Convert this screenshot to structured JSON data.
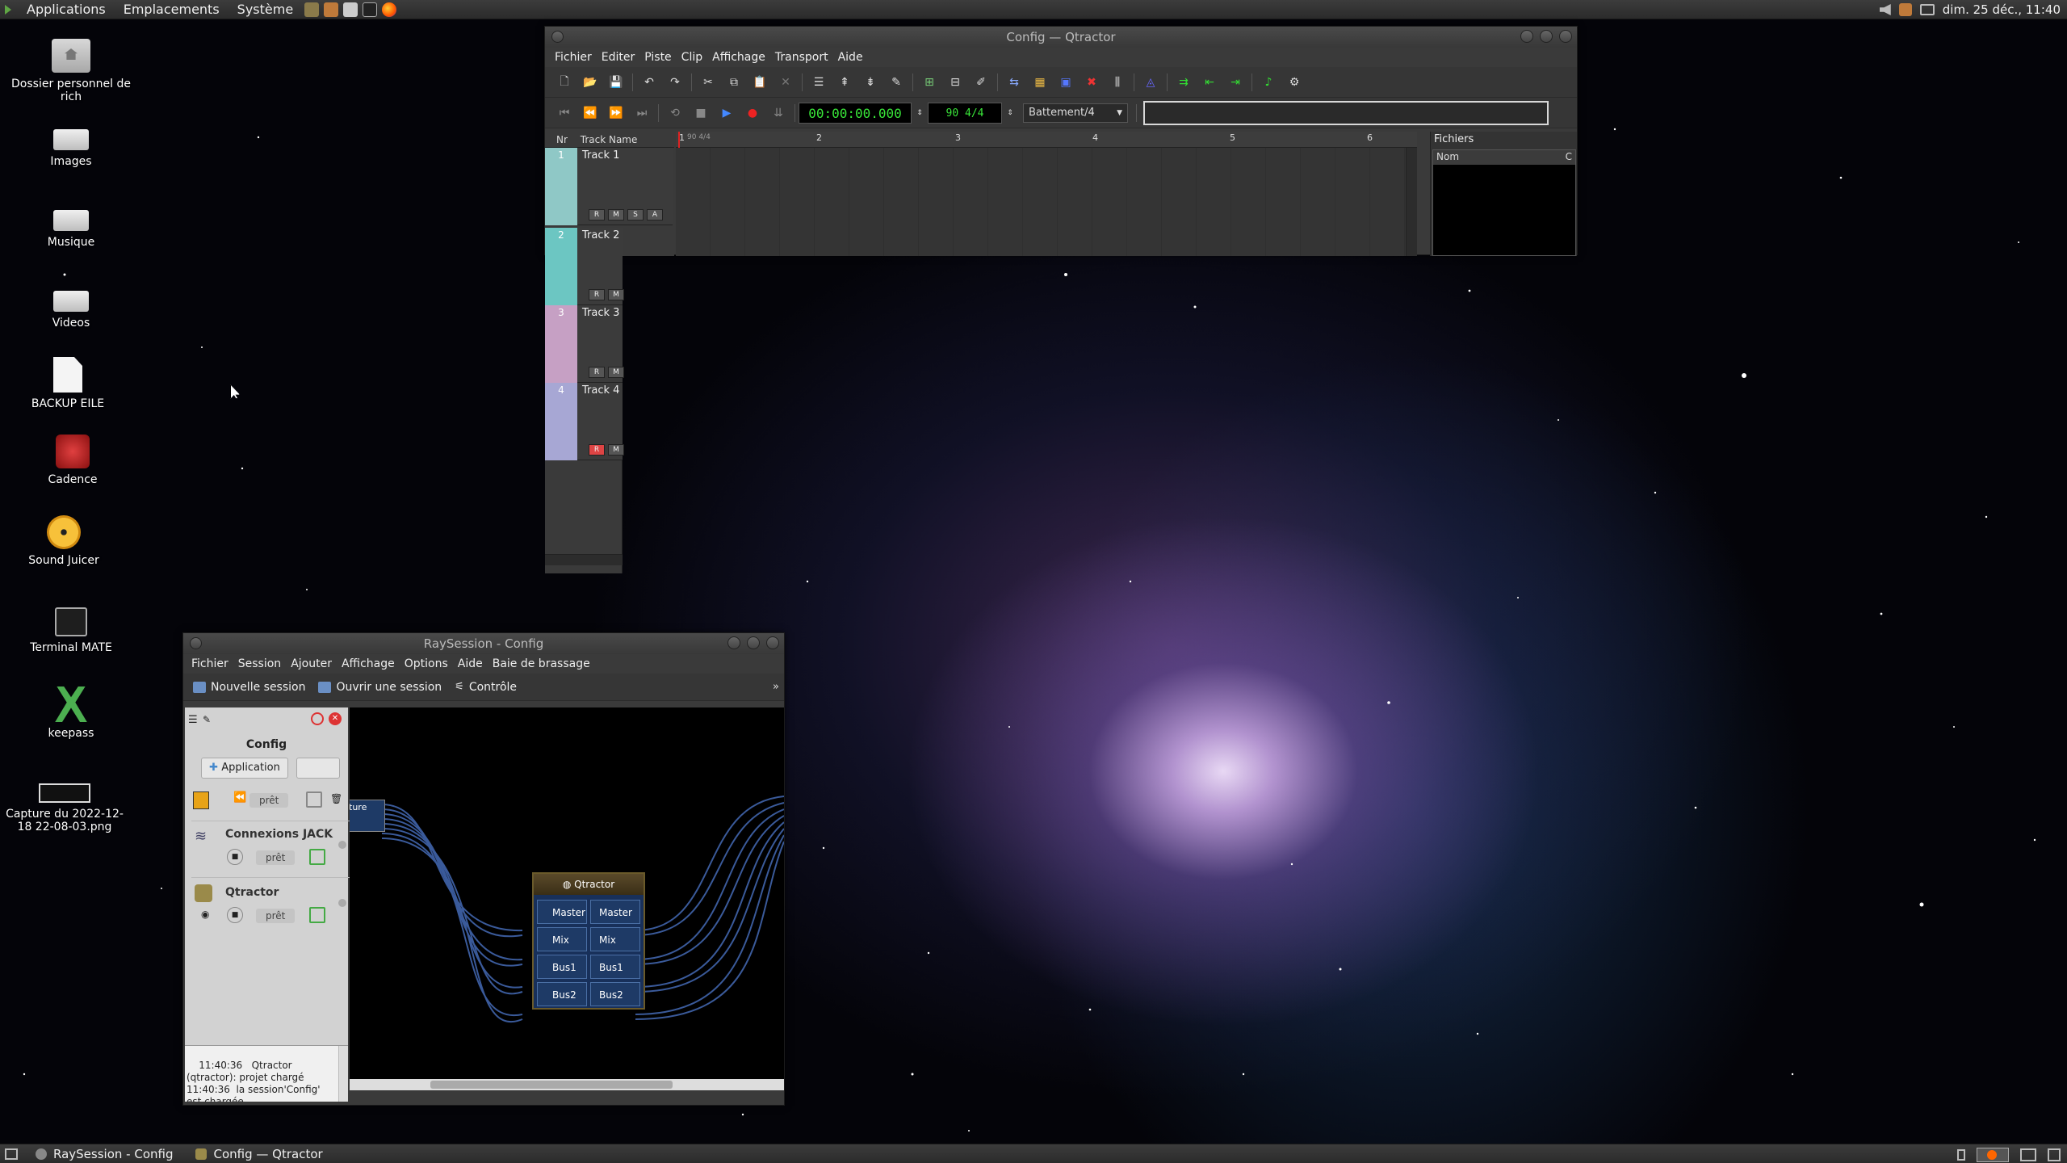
{
  "top_panel": {
    "menus": [
      "Applications",
      "Emplacements",
      "Système"
    ],
    "clock": "dim. 25 déc., 11:40"
  },
  "desktop_icons": [
    {
      "label": "Dossier personnel de rich",
      "icon": "home-folder-icon"
    },
    {
      "label": "Images",
      "icon": "drive-icon"
    },
    {
      "label": "Musique",
      "icon": "drive-icon"
    },
    {
      "label": "Videos",
      "icon": "drive-icon"
    },
    {
      "label": "BACKUP EILE",
      "icon": "file-icon"
    },
    {
      "label": "Cadence",
      "icon": "cadence-icon"
    },
    {
      "label": "Sound Juicer",
      "icon": "cd-icon"
    },
    {
      "label": "Terminal MATE",
      "icon": "terminal-icon"
    },
    {
      "label": "keepass",
      "icon": "keepass-icon"
    },
    {
      "label": "Capture du 2022-12-18 22-08-03.png",
      "icon": "screenshot-icon"
    }
  ],
  "qtractor": {
    "title": "Config — Qtractor",
    "menus": [
      "Fichier",
      "Editer",
      "Piste",
      "Clip",
      "Affichage",
      "Transport",
      "Aide"
    ],
    "time": "00:00:00.000",
    "tempo": "90 4/4",
    "snap": "Battement/4",
    "headers": {
      "nr": "Nr",
      "track_name": "Track Name"
    },
    "ruler": {
      "first": "1",
      "first_sig": "90 4/4",
      "marks": [
        "2",
        "3",
        "4",
        "5",
        "6"
      ]
    },
    "tracks": [
      {
        "nr": "1",
        "name": "Track 1",
        "color": "#8fc8c6"
      },
      {
        "nr": "2",
        "name": "Track 2",
        "color": "#6cc6c2"
      },
      {
        "nr": "3",
        "name": "Track 3",
        "color": "#c6a0c4"
      },
      {
        "nr": "4",
        "name": "Track 4",
        "color": "#a7a7d4"
      }
    ],
    "track_buttons": [
      "R",
      "M",
      "S",
      "A"
    ],
    "files_panel": {
      "title": "Fichiers",
      "col_name": "Nom",
      "col_c": "C"
    }
  },
  "raysession": {
    "title": "RaySession - Config",
    "menus": [
      "Fichier",
      "Session",
      "Ajouter",
      "Affichage",
      "Options",
      "Aide",
      "Baie de brassage"
    ],
    "toolbar": {
      "new_session": "Nouvelle session",
      "open_session": "Ouvrir une session",
      "control": "Contrôle"
    },
    "session_name": "Config",
    "add_application": "Application",
    "status_ready": "prêt",
    "clients": [
      {
        "name": "Connexions JACK",
        "status": "prêt"
      },
      {
        "name": "Qtractor",
        "status": "prêt"
      }
    ],
    "log": "11:40:36   Qtractor (qtractor): projet chargé\n11:40:36  la session'Config' est chargée.",
    "patchbay": {
      "capture_label": "ture",
      "box_title": "Qtractor",
      "ports_in": [
        "Master",
        "Mix",
        "Bus1",
        "Bus2"
      ],
      "ports_out": [
        "Master",
        "Mix",
        "Bus1",
        "Bus2"
      ]
    }
  },
  "taskbar": {
    "items": [
      "RaySession - Config",
      "Config — Qtractor"
    ]
  }
}
